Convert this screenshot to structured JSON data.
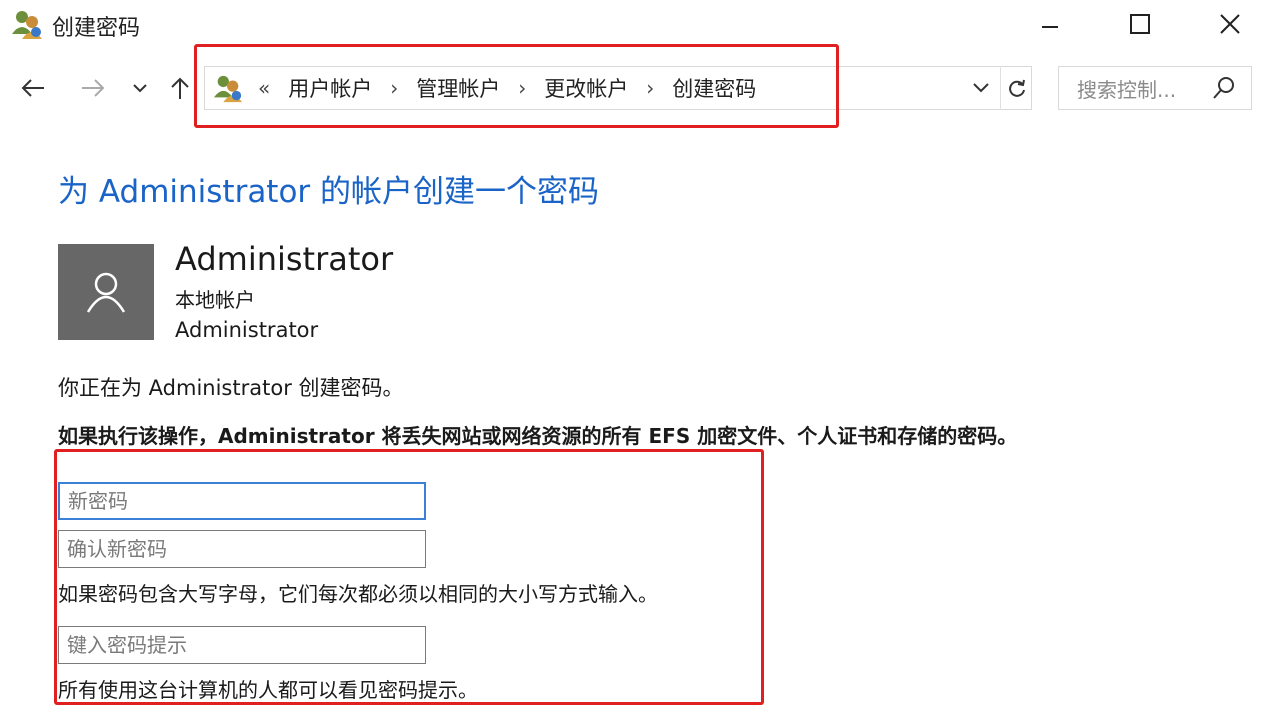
{
  "window": {
    "title": "创建密码"
  },
  "nav": {
    "back": "back",
    "forward": "forward",
    "recent": "recent",
    "up": "up"
  },
  "breadcrumb": {
    "lead": "«",
    "items": [
      "用户帐户",
      "管理帐户",
      "更改帐户",
      "创建密码"
    ],
    "separator": "›"
  },
  "search": {
    "placeholder": "搜索控制..."
  },
  "page": {
    "heading": "为 Administrator 的帐户创建一个密码",
    "user": {
      "name": "Administrator",
      "type": "本地帐户",
      "account": "Administrator"
    },
    "message": "你正在为 Administrator 创建密码。",
    "warning": "如果执行该操作，Administrator 将丢失网站或网络资源的所有 EFS 加密文件、个人证书和存储的密码。"
  },
  "form": {
    "new_password_placeholder": "新密码",
    "confirm_password_placeholder": "确认新密码",
    "caps_note": "如果密码包含大写字母，它们每次都必须以相同的大小写方式输入。",
    "hint_placeholder": "键入密码提示",
    "hint_note": "所有使用这台计算机的人都可以看见密码提示。"
  },
  "colors": {
    "accent": "#1a63c7",
    "highlight": "#e02020",
    "avatar_bg": "#676767"
  }
}
